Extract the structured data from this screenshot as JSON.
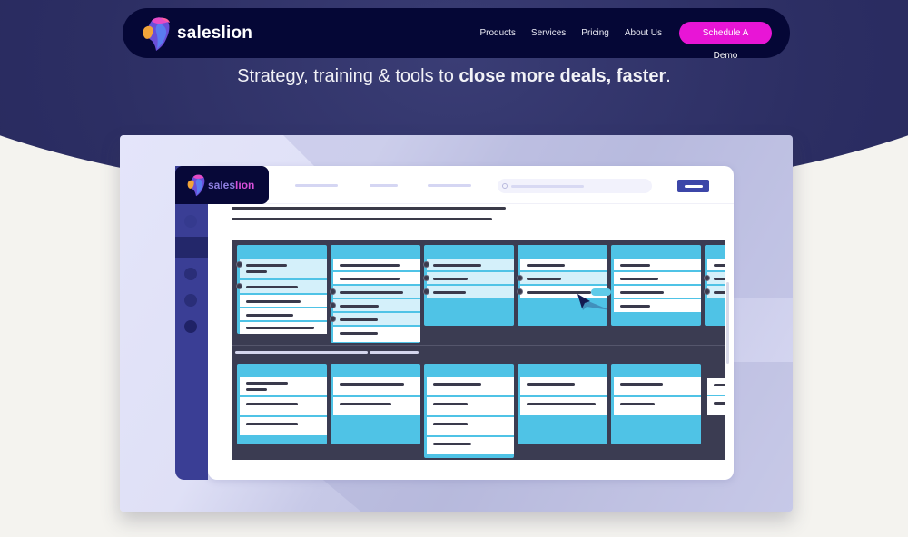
{
  "navbar": {
    "brand_name": "saleslion",
    "links": [
      "Products",
      "Services",
      "Pricing",
      "About Us"
    ],
    "cta_label": "Schedule A Demo"
  },
  "hero": {
    "tagline_prefix": "Strategy, training & tools to ",
    "tagline_bold": "close more deals, faster",
    "tagline_suffix": "."
  },
  "app_mock": {
    "logo_text_a": "sales",
    "logo_text_b": "lion",
    "icons": [
      "lion-logo-icon",
      "search-icon",
      "cursor-arrow-icon"
    ]
  },
  "colors": {
    "brand_dark": "#050736",
    "cta_magenta": "#e815d6",
    "board_dark": "#3b3c52",
    "column_cyan": "#4fc3e6",
    "sidebar_indigo": "#3a3e95"
  }
}
